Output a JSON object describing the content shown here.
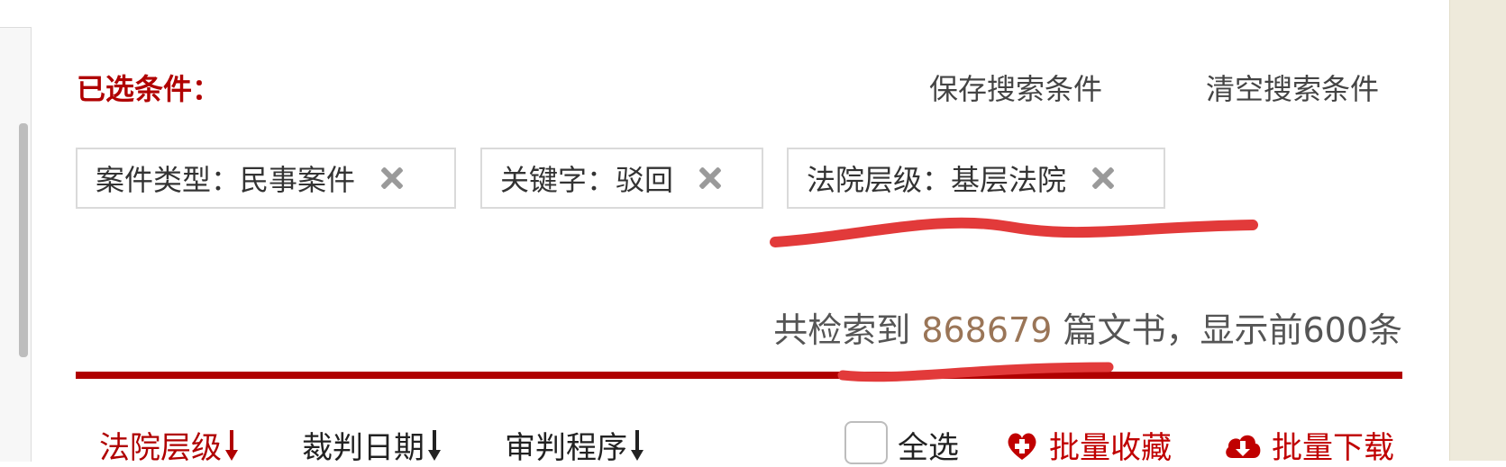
{
  "header": {
    "title": "已选条件：",
    "save_label": "保存搜索条件",
    "clear_label": "清空搜索条件"
  },
  "filters": [
    {
      "label": "案件类型：民事案件"
    },
    {
      "label": "关键字：驳回"
    },
    {
      "label": "法院层级：基层法院"
    }
  ],
  "results": {
    "prefix": "共检索到",
    "count": "868679",
    "suffix": "篇文书，显示前600条"
  },
  "sort": [
    {
      "label": "法院层级"
    },
    {
      "label": "裁判日期"
    },
    {
      "label": "审判程序"
    }
  ],
  "actions": {
    "select_all": "全选",
    "batch_favorite": "批量收藏",
    "batch_download": "批量下载"
  },
  "colors": {
    "accent": "#b00000",
    "count": "#9a7557",
    "annotation": "#e23a3a"
  }
}
